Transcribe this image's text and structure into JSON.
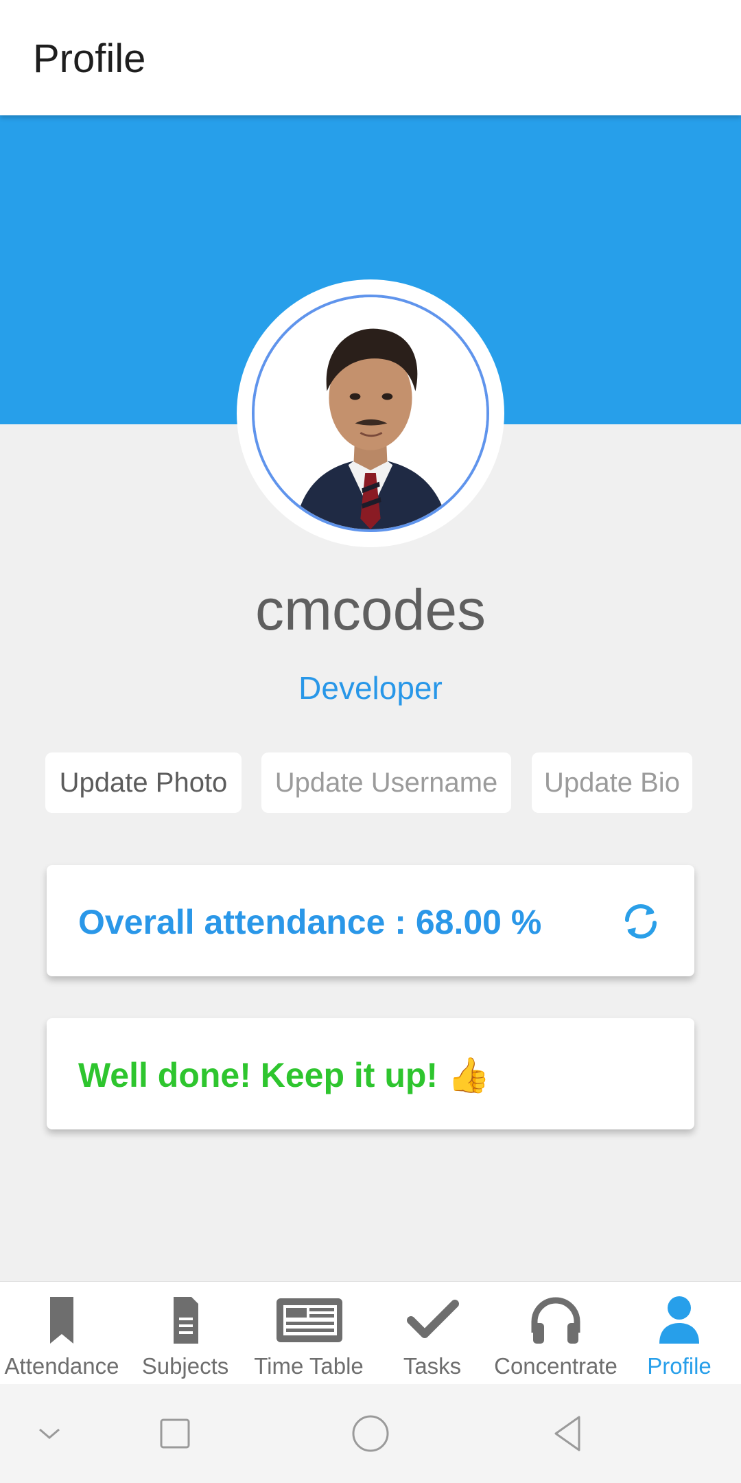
{
  "app_bar": {
    "title": "Profile"
  },
  "profile": {
    "username": "cmcodes",
    "bio": "Developer",
    "avatar_icon": "user-photo"
  },
  "actions": {
    "update_photo": "Update Photo",
    "update_username": "Update Username",
    "update_bio": "Update Bio"
  },
  "attendance_card": {
    "text": "Overall attendance : 68.00 %",
    "refresh_icon": "refresh-icon"
  },
  "message_card": {
    "text": "Well done! Keep it up! 👍"
  },
  "bottom_nav": {
    "items": [
      {
        "label": "Attendance",
        "icon": "bookmark-icon"
      },
      {
        "label": "Subjects",
        "icon": "document-icon"
      },
      {
        "label": "Time Table",
        "icon": "newspaper-icon"
      },
      {
        "label": "Tasks",
        "icon": "check-icon"
      },
      {
        "label": "Concentrate",
        "icon": "headphones-icon"
      },
      {
        "label": "Profile",
        "icon": "person-icon"
      }
    ],
    "active": "Profile"
  },
  "system_nav": {
    "icons": [
      "chevron-down-icon",
      "square-icon",
      "circle-icon",
      "triangle-back-icon"
    ]
  },
  "colors": {
    "primary": "#279fea",
    "success": "#2ec52e",
    "nav_inactive": "#6e6e6e"
  }
}
